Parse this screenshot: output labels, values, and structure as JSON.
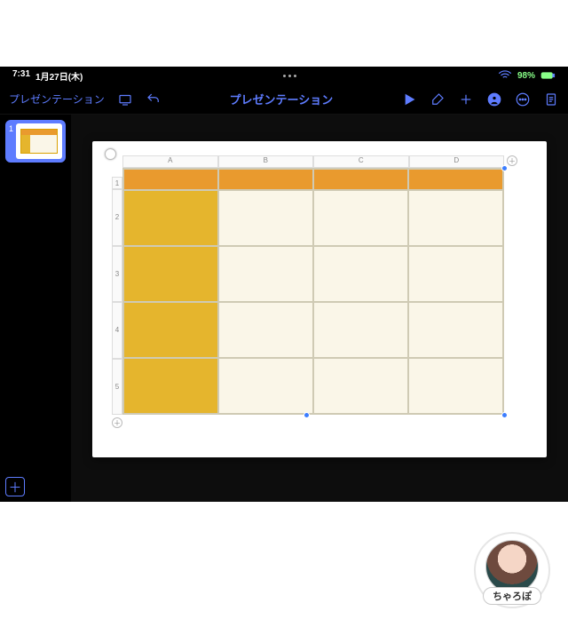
{
  "status": {
    "time": "7:31",
    "date": "1月27日(木)",
    "battery": "98%"
  },
  "toolbar": {
    "back": "プレゼンテーション",
    "title": "プレゼンテーション"
  },
  "sidebar": {
    "slideNumber": "1"
  },
  "table": {
    "columns": [
      "A",
      "B",
      "C",
      "D"
    ],
    "rows": [
      "1",
      "2",
      "3",
      "4",
      "5"
    ],
    "addColumn": "＋",
    "addRow": "＋",
    "colors": {
      "header": "#e99a2e",
      "rowHeader": "#e5b52d",
      "body": "#faf6e8"
    }
  },
  "avatar": {
    "name": "ちゃろぽ"
  }
}
